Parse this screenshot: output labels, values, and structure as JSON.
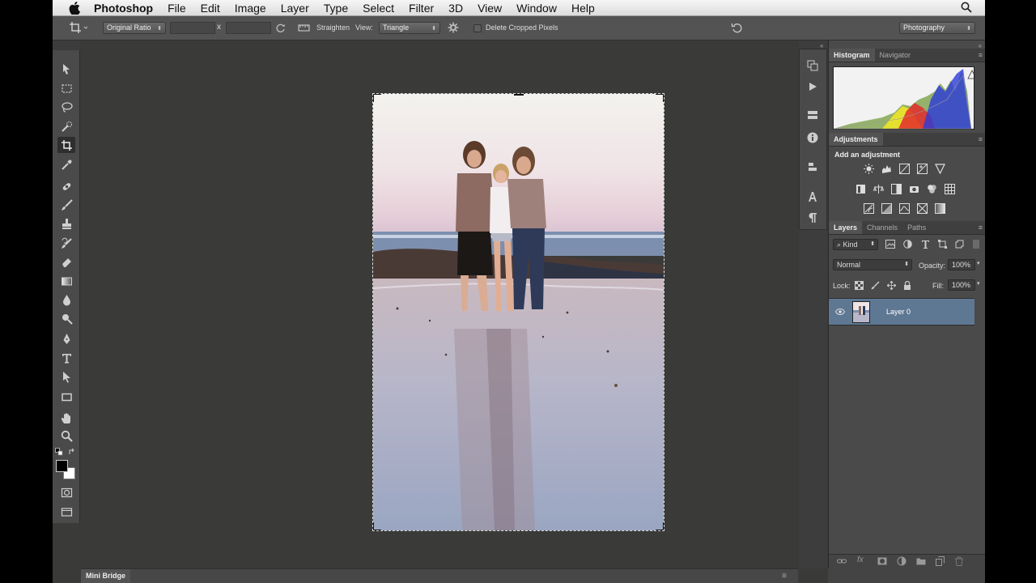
{
  "menu": {
    "app_name": "Photoshop",
    "items": [
      "File",
      "Edit",
      "Image",
      "Layer",
      "Type",
      "Select",
      "Filter",
      "3D",
      "View",
      "Window",
      "Help"
    ]
  },
  "options_bar": {
    "ratio": "Original Ratio",
    "x_separator": "x",
    "straighten_label": "Straighten",
    "view_label": "View:",
    "view_value": "Triangle",
    "delete_cropped_label": "Delete Cropped Pixels",
    "delete_cropped_checked": false,
    "workspace": "Photography"
  },
  "tools": [
    {
      "name": "move",
      "active": false
    },
    {
      "name": "marquee",
      "active": false
    },
    {
      "name": "lasso",
      "active": false
    },
    {
      "name": "quick-select",
      "active": false
    },
    {
      "name": "crop",
      "active": true
    },
    {
      "name": "eyedropper",
      "active": false
    },
    {
      "name": "healing",
      "active": false
    },
    {
      "name": "brush",
      "active": false
    },
    {
      "name": "clone-stamp",
      "active": false
    },
    {
      "name": "history-brush",
      "active": false
    },
    {
      "name": "eraser",
      "active": false
    },
    {
      "name": "gradient",
      "active": false
    },
    {
      "name": "blur",
      "active": false
    },
    {
      "name": "dodge",
      "active": false
    },
    {
      "name": "pen",
      "active": false
    },
    {
      "name": "type",
      "active": false
    },
    {
      "name": "path-select",
      "active": false
    },
    {
      "name": "rectangle",
      "active": false
    },
    {
      "name": "hand",
      "active": false
    },
    {
      "name": "zoom",
      "active": false
    }
  ],
  "colors": {
    "foreground": "#000000",
    "background": "#ffffff"
  },
  "panels": {
    "histogram_tabs": [
      "Histogram",
      "Navigator"
    ],
    "adjustments_tab": "Adjustments",
    "adjustments_heading": "Add an adjustment",
    "layers_tabs": [
      "Layers",
      "Channels",
      "Paths"
    ],
    "filter_kind": "Kind",
    "blend_mode": "Normal",
    "opacity_label": "Opacity:",
    "opacity_value": "100%",
    "lock_label": "Lock:",
    "fill_label": "Fill:",
    "fill_value": "100%",
    "layers": [
      {
        "name": "Layer 0",
        "visible": true,
        "selected": true
      }
    ]
  },
  "bottom": {
    "mini_bridge": "Mini Bridge"
  }
}
